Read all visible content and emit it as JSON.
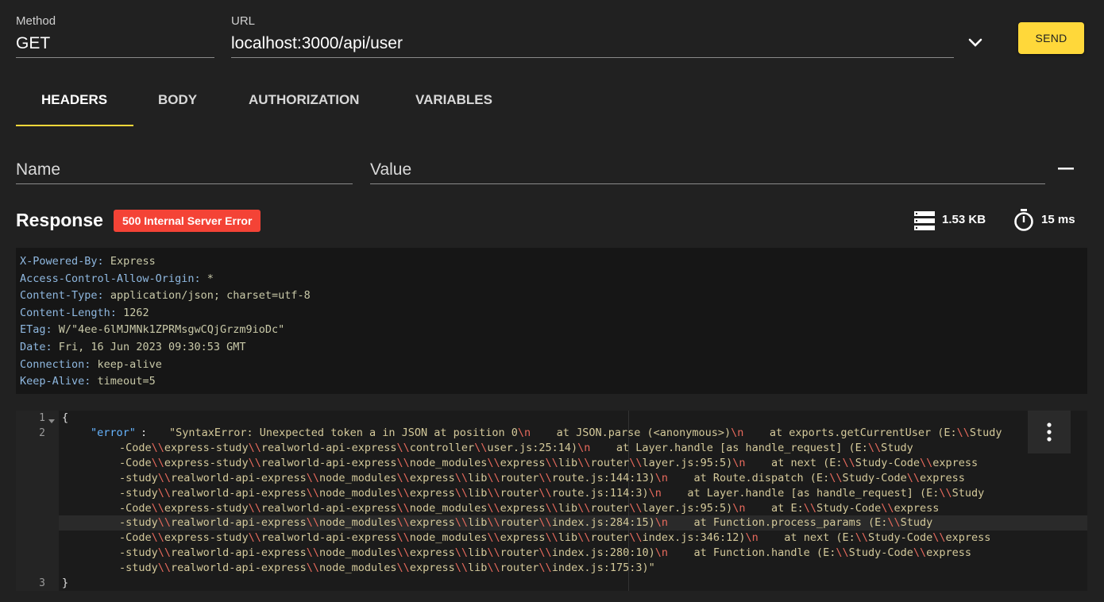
{
  "request": {
    "method_label": "Method",
    "method_value": "GET",
    "url_label": "URL",
    "url_value": "localhost:3000/api/user",
    "send_label": "SEND"
  },
  "tabs": [
    {
      "label": "HEADERS",
      "active": true
    },
    {
      "label": "BODY",
      "active": false
    },
    {
      "label": "AUTHORIZATION",
      "active": false
    },
    {
      "label": "VARIABLES",
      "active": false
    }
  ],
  "header_inputs": {
    "name_placeholder": "Name",
    "value_placeholder": "Value"
  },
  "response": {
    "title": "Response",
    "status": "500 Internal Server Error",
    "status_color": "#f44336",
    "size": "1.53 KB",
    "time": "15 ms",
    "headers": [
      {
        "key": "X-Powered-By",
        "value": "Express"
      },
      {
        "key": "Access-Control-Allow-Origin",
        "value": "*"
      },
      {
        "key": "Content-Type",
        "value": "application/json; charset=utf-8"
      },
      {
        "key": "Content-Length",
        "value": "1262"
      },
      {
        "key": "ETag",
        "value": "W/\"4ee-6lMJMNk1ZPRMsgwCQjGrzm9ioDc\""
      },
      {
        "key": "Date",
        "value": "Fri, 16 Jun 2023 09:30:53 GMT"
      },
      {
        "key": "Connection",
        "value": "keep-alive"
      },
      {
        "key": "Keep-Alive",
        "value": "timeout=5"
      }
    ],
    "body": {
      "line_numbers": [
        "1",
        "2",
        "3"
      ],
      "open_brace": "{",
      "close_brace": "}",
      "key": "\"error\"",
      "wrapped_lines": [
        "\"SyntaxError: Unexpected token a in JSON at position 0\\n    at JSON.parse (<anonymous>)\\n    at exports.getCurrentUser (E:\\\\Study",
        "-Code\\\\express-study\\\\realworld-api-express\\\\controller\\\\user.js:25:14)\\n    at Layer.handle [as handle_request] (E:\\\\Study",
        "-Code\\\\express-study\\\\realworld-api-express\\\\node_modules\\\\express\\\\lib\\\\router\\\\layer.js:95:5)\\n    at next (E:\\\\Study-Code\\\\express",
        "-study\\\\realworld-api-express\\\\node_modules\\\\express\\\\lib\\\\router\\\\route.js:144:13)\\n    at Route.dispatch (E:\\\\Study-Code\\\\express",
        "-study\\\\realworld-api-express\\\\node_modules\\\\express\\\\lib\\\\router\\\\route.js:114:3)\\n    at Layer.handle [as handle_request] (E:\\\\Study",
        "-Code\\\\express-study\\\\realworld-api-express\\\\node_modules\\\\express\\\\lib\\\\router\\\\layer.js:95:5)\\n    at E:\\\\Study-Code\\\\express",
        "-study\\\\realworld-api-express\\\\node_modules\\\\express\\\\lib\\\\router\\\\index.js:284:15)\\n    at Function.process_params (E:\\\\Study",
        "-Code\\\\express-study\\\\realworld-api-express\\\\node_modules\\\\express\\\\lib\\\\router\\\\index.js:346:12)\\n    at next (E:\\\\Study-Code\\\\express",
        "-study\\\\realworld-api-express\\\\node_modules\\\\express\\\\lib\\\\router\\\\index.js:280:10)\\n    at Function.handle (E:\\\\Study-Code\\\\express",
        "-study\\\\realworld-api-express\\\\node_modules\\\\express\\\\lib\\\\router\\\\index.js:175:3)\""
      ]
    }
  },
  "icons": {
    "size": "storage-icon",
    "time": "timer-icon",
    "dropdown": "chevron-down-icon",
    "remove": "minus-icon",
    "more": "more-vertical-icon",
    "fold": "fold-caret-icon"
  },
  "colors": {
    "accent": "#ffd83a",
    "background": "#212121",
    "error": "#f44336"
  }
}
